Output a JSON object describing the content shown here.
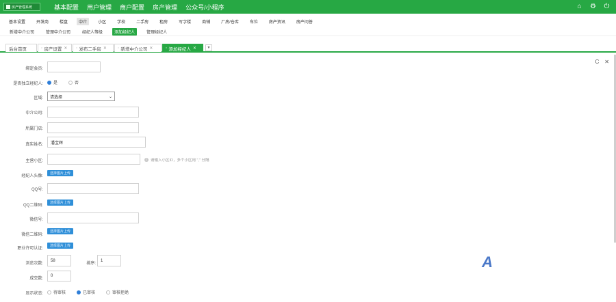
{
  "app": {
    "logo_text": "房产管理系统"
  },
  "topnav": [
    "基本配置",
    "用户管理",
    "商户配置",
    "房产管理",
    "公众号/小程序"
  ],
  "top_icons": {
    "home": "⌂",
    "settings": "⚙",
    "power": "⏻"
  },
  "nav2": [
    "基本设置",
    "开发商",
    "楼盘",
    "中介",
    "小区",
    "学校",
    "二手房",
    "租房",
    "写字楼",
    "商铺",
    "厂房/仓库",
    "车位",
    "房产资讯",
    "房产问答"
  ],
  "nav2_active": "中介",
  "nav3": [
    "新增中介公司",
    "管理中介公司",
    "经纪人等级",
    "添加经纪人",
    "管理经纪人"
  ],
  "nav3_active": "添加经纪人",
  "tabs": [
    {
      "label": "后台首页",
      "closable": false
    },
    {
      "label": "房产设置",
      "closable": true
    },
    {
      "label": "发布二手房",
      "closable": true
    },
    {
      "label": "新增中介公司",
      "closable": true
    },
    {
      "label": "添加经纪人",
      "closable": true,
      "active": true
    }
  ],
  "tab_add": "▼",
  "tools": {
    "refresh": "C",
    "close": "✕"
  },
  "form": {
    "bind_member_label": "绑定会员:",
    "bind_member_value": "",
    "independent_label": "是否独立经纪人:",
    "independent_yes": "是",
    "independent_no": "否",
    "region_label": "区域:",
    "region_value": "请选择",
    "company_label": "中介公司:",
    "company_value": "",
    "store_label": "所属门店:",
    "store_value": "",
    "name_label": "真实姓名:",
    "name_value": "潘宝辉",
    "community_label": "主营小区:",
    "community_value": "",
    "community_hint": "请输入小区ID，多个小区用 \",\" 分隔",
    "avatar_label": "经纪人头像:",
    "upload_btn": "选择图片上传",
    "qq_label": "QQ号:",
    "qq_value": "",
    "qq_qr_label": "QQ二维码:",
    "wechat_label": "微信号:",
    "wechat_value": "",
    "wechat_qr_label": "微信二维码:",
    "license_label": "职业许可认证:",
    "views_label": "浏览次数:",
    "views_value": "58",
    "sort_label": "排序:",
    "sort_value": "1",
    "deals_label": "成交数:",
    "deals_value": "0",
    "status_label": "显示状态:",
    "status_options": [
      "待审核",
      "已审核",
      "审核拒绝"
    ],
    "status_selected": "已审核"
  },
  "watermark": "A"
}
